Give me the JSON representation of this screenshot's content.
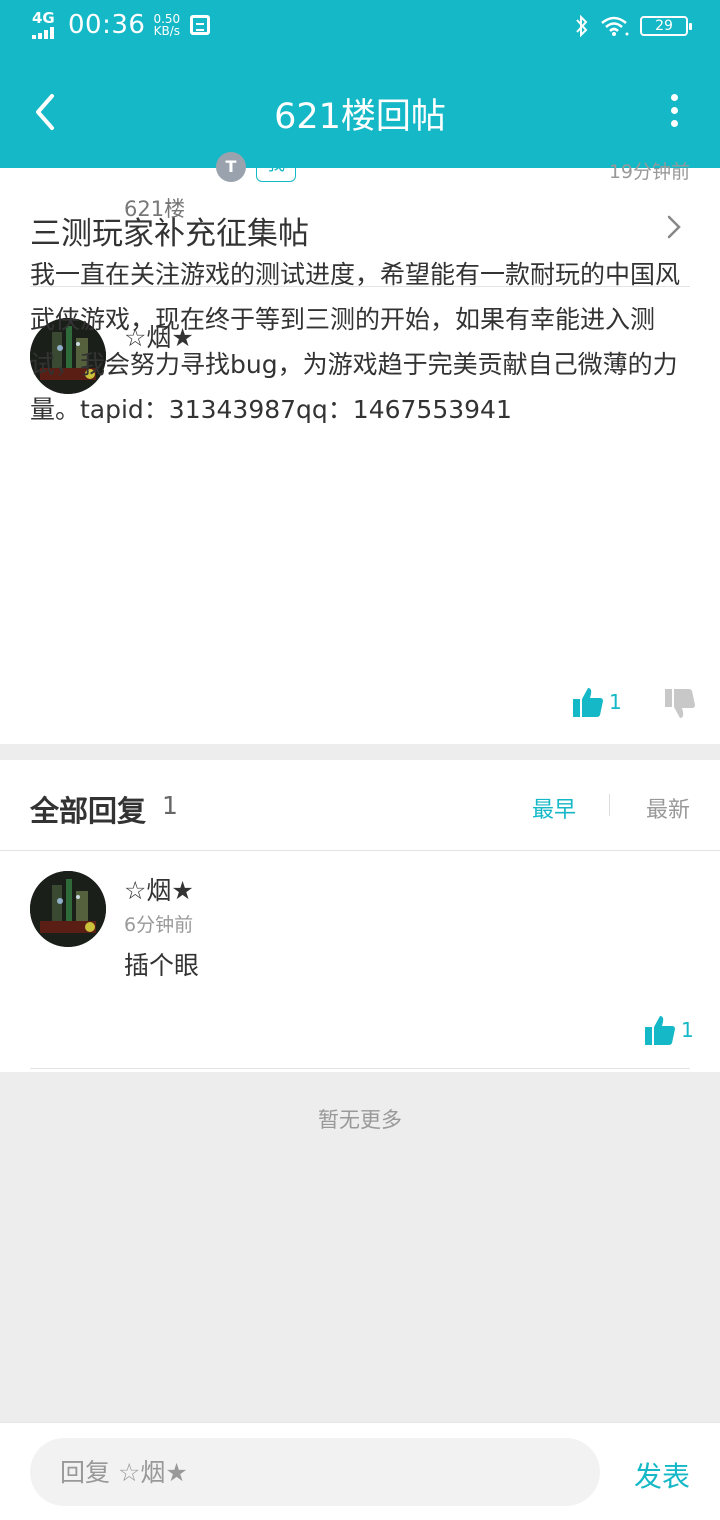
{
  "status_bar": {
    "network": "4G",
    "time": "00:36",
    "speed_value": "0.50",
    "speed_unit": "KB/s",
    "battery": "29"
  },
  "nav": {
    "title": "621楼回帖"
  },
  "topic": {
    "title": "三测玩家补充征集帖"
  },
  "post": {
    "author": "☆烟★",
    "level_badge": "T",
    "me_badge": "我",
    "floor": "621楼",
    "time": "19分钟前",
    "content": "我一直在关注游戏的测试进度，希望能有一款耐玩的中国风武侠游戏，现在终于等到三测的开始，如果有幸能进入测试，我会努力寻找bug，为游戏趋于完美贡献自己微薄的力量。tapid：31343987qq：1467553941",
    "like_count": "1"
  },
  "replies": {
    "title": "全部回复",
    "count": "1",
    "sort_earliest": "最早",
    "sort_newest": "最新",
    "items": [
      {
        "author": "☆烟★",
        "time": "6分钟前",
        "content": "插个眼",
        "like_count": "1"
      }
    ]
  },
  "footer": {
    "no_more": "暂无更多"
  },
  "bottom_bar": {
    "placeholder": "回复 ☆烟★",
    "send": "发表"
  },
  "colors": {
    "accent": "#15b8c6",
    "background": "#ededed"
  }
}
